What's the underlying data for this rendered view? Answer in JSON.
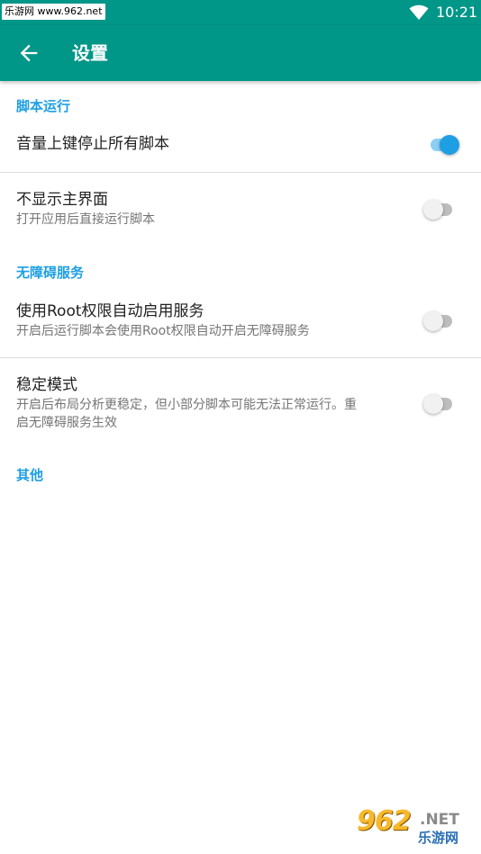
{
  "status_bar": {
    "watermark": "乐游网 www.962.net",
    "time": "10:21",
    "wifi_icon": "wifi-icon"
  },
  "app_bar": {
    "title": "设置",
    "back_icon": "arrow-back-icon"
  },
  "categories": {
    "script_run": "脚本运行",
    "accessibility": "无障碍服务",
    "other": "其他"
  },
  "preferences": {
    "volume_stop": {
      "title": "音量上键停止所有脚本",
      "enabled": true
    },
    "hide_main": {
      "title": "不显示主界面",
      "summary": "打开应用后直接运行脚本",
      "enabled": false
    },
    "root_accessibility": {
      "title": "使用Root权限自动启用服务",
      "summary": "开启后运行脚本会使用Root权限自动开启无障碍服务",
      "enabled": false
    },
    "stable_mode": {
      "title": "稳定模式",
      "summary_line1": "开启后布局分析更稳定，但小部分脚本可能无法正常运行。重",
      "summary_line2": "启无障碍服务生效",
      "enabled": false
    }
  },
  "colors": {
    "primary": "#009688",
    "accent": "#1e9fe3",
    "switch_on_track": "#8ccff4",
    "switch_off_track": "#bdbdbd"
  },
  "logo": {
    "main": "962",
    "suffix": ".NET",
    "sub": "乐游网"
  }
}
